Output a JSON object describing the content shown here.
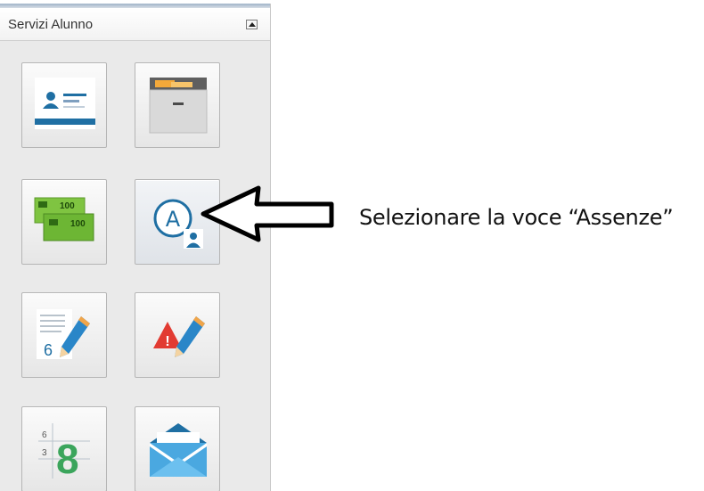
{
  "panel": {
    "title": "Servizi Alunno",
    "collapse_icon": "collapse-up-icon",
    "tiles": [
      {
        "icon": "student-card-icon"
      },
      {
        "icon": "file-cabinet-icon"
      },
      {
        "icon": "banknotes-icon",
        "note_value_1": "100",
        "note_value_2": "100"
      },
      {
        "icon": "absences-icon",
        "glyph": "A"
      },
      {
        "icon": "grades-notebook-icon",
        "glyph": "6"
      },
      {
        "icon": "disciplinary-note-icon",
        "glyph": "!"
      },
      {
        "icon": "marks-table-icon",
        "glyph_big": "8",
        "glyph_small_1": "6",
        "glyph_small_2": "3"
      },
      {
        "icon": "envelope-icon"
      }
    ]
  },
  "annotation": {
    "text": "Selezionare la voce “Assenze”",
    "arrow_icon": "left-arrow-icon"
  },
  "colors": {
    "panel_bg": "#eaeaea",
    "accent_blue": "#1f6fa3",
    "green_note": "#7fc441",
    "warning_red": "#e23b32"
  }
}
